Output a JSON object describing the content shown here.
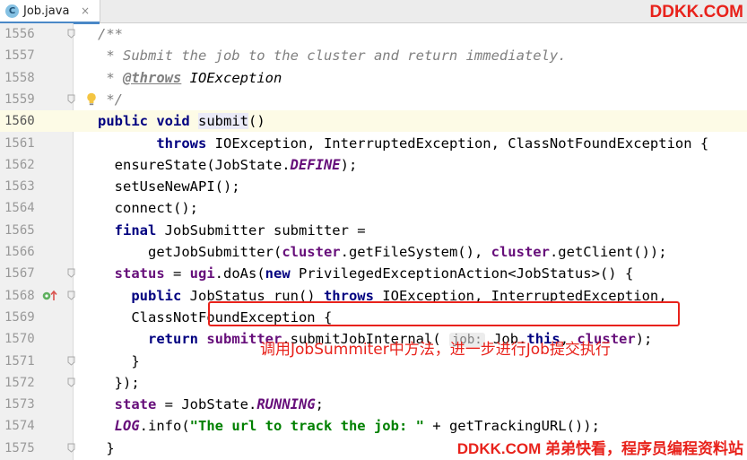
{
  "tab": {
    "file_icon_letter": "C",
    "label": "Job.java",
    "close_glyph": "×"
  },
  "watermark_top": "DDKK.COM",
  "watermark_bottom": "DDKK.COM 弟弟快看，程序员编程资料站",
  "annotation": "调用JobSummiter中方法，进一步进行Job提交执行",
  "current_line": "1560",
  "lines": [
    {
      "n": "1556",
      "gutter": "fold",
      "tokens": [
        {
          "t": "/**",
          "s": "c"
        }
      ]
    },
    {
      "n": "1557",
      "tokens": [
        {
          "t": " * Submit the job to the cluster and return immediately.",
          "s": "c"
        }
      ]
    },
    {
      "n": "1558",
      "tokens": [
        {
          "t": " * ",
          "s": "c"
        },
        {
          "t": "@throws",
          "s": "ctag"
        },
        {
          "t": " IOException",
          "s": "cb"
        }
      ]
    },
    {
      "n": "1559",
      "gutter": "fold",
      "bulb": true,
      "tokens": [
        {
          "t": " */",
          "s": "c"
        }
      ]
    },
    {
      "n": "1560",
      "tokens": [
        {
          "t": "public",
          "s": "k"
        },
        {
          "t": " "
        },
        {
          "t": "void",
          "s": "k"
        },
        {
          "t": " "
        },
        {
          "t": "submit",
          "s": "fn"
        },
        {
          "t": "()"
        }
      ]
    },
    {
      "n": "1561",
      "tokens": [
        {
          "t": "       "
        },
        {
          "t": "throws",
          "s": "k"
        },
        {
          "t": " IOException, InterruptedException, ClassNotFoundException {"
        }
      ]
    },
    {
      "n": "1562",
      "tokens": [
        {
          "t": "  ensureState(JobState."
        },
        {
          "t": "DEFINE",
          "s": "fi"
        },
        {
          "t": ");"
        }
      ]
    },
    {
      "n": "1563",
      "tokens": [
        {
          "t": "  setUseNewAPI();"
        }
      ]
    },
    {
      "n": "1564",
      "tokens": [
        {
          "t": "  connect();"
        }
      ]
    },
    {
      "n": "1565",
      "tokens": [
        {
          "t": "  "
        },
        {
          "t": "final",
          "s": "k"
        },
        {
          "t": " JobSubmitter submitter ="
        }
      ]
    },
    {
      "n": "1566",
      "tokens": [
        {
          "t": "      getJobSubmitter("
        },
        {
          "t": "cluster",
          "s": "f"
        },
        {
          "t": ".getFileSystem(), "
        },
        {
          "t": "cluster",
          "s": "f"
        },
        {
          "t": ".getClient());"
        }
      ]
    },
    {
      "n": "1567",
      "gutter": "fold",
      "tokens": [
        {
          "t": "  "
        },
        {
          "t": "status",
          "s": "f"
        },
        {
          "t": " = "
        },
        {
          "t": "ugi",
          "s": "f"
        },
        {
          "t": ".doAs("
        },
        {
          "t": "new",
          "s": "k"
        },
        {
          "t": " PrivilegedExceptionAction<JobStatus>() {"
        }
      ]
    },
    {
      "n": "1568",
      "gutter": "fold",
      "overrides": true,
      "tokens": [
        {
          "t": "    "
        },
        {
          "t": "public",
          "s": "k"
        },
        {
          "t": " JobStatus run() "
        },
        {
          "t": "throws",
          "s": "k"
        },
        {
          "t": " IOException, InterruptedException,"
        }
      ]
    },
    {
      "n": "1569",
      "tokens": [
        {
          "t": "    ClassNotFoundException {"
        }
      ]
    },
    {
      "n": "1570",
      "tokens": [
        {
          "t": "      "
        },
        {
          "t": "return",
          "s": "k"
        },
        {
          "t": " "
        },
        {
          "t": "submitter",
          "s": "f"
        },
        {
          "t": ".submitJobInternal( "
        },
        {
          "t": "job:",
          "s": "h"
        },
        {
          "t": " Job."
        },
        {
          "t": "this",
          "s": "k"
        },
        {
          "t": ", "
        },
        {
          "t": "cluster",
          "s": "f"
        },
        {
          "t": ");"
        }
      ]
    },
    {
      "n": "1571",
      "gutter": "fold",
      "tokens": [
        {
          "t": "    }"
        }
      ]
    },
    {
      "n": "1572",
      "gutter": "fold",
      "tokens": [
        {
          "t": "  });"
        }
      ]
    },
    {
      "n": "1573",
      "tokens": [
        {
          "t": "  "
        },
        {
          "t": "state",
          "s": "f"
        },
        {
          "t": " = JobState."
        },
        {
          "t": "RUNNING",
          "s": "fi"
        },
        {
          "t": ";"
        }
      ]
    },
    {
      "n": "1574",
      "tokens": [
        {
          "t": "  "
        },
        {
          "t": "LOG",
          "s": "fi"
        },
        {
          "t": ".info("
        },
        {
          "t": "\"The url to track the job: \"",
          "s": "s"
        },
        {
          "t": " + getTrackingURL());"
        }
      ]
    },
    {
      "n": "1575",
      "gutter": "fold",
      "tokens": [
        {
          "t": " }"
        }
      ]
    }
  ]
}
